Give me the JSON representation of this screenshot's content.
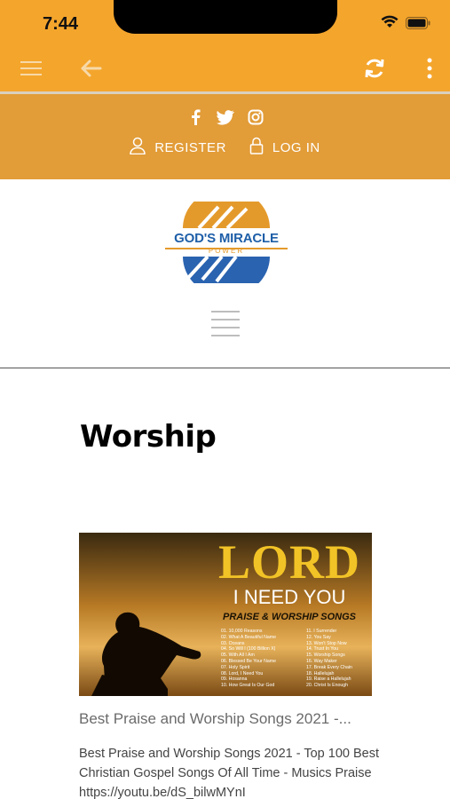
{
  "status_bar": {
    "time": "7:44"
  },
  "colors": {
    "app_bar": "#F4A52C",
    "site_header": "#E29C38",
    "logo_blue": "#1f5fa8",
    "logo_orange": "#E49A2B"
  },
  "toolbar": {
    "menu_icon": "hamburger-icon",
    "back_icon": "arrow-left-icon",
    "refresh_icon": "refresh-icon",
    "more_icon": "more-vertical-icon"
  },
  "header": {
    "social": [
      "facebook-icon",
      "twitter-icon",
      "instagram-icon"
    ],
    "register_label": "REGISTER",
    "login_label": "LOG IN"
  },
  "logo": {
    "title": "GOD'S MIRACLE",
    "subtitle": "POWER"
  },
  "main": {
    "page_title": "Worship",
    "post": {
      "thumbnail": {
        "headline": "LORD",
        "subheadline": "I NEED YOU",
        "tagline": "PRAISE & WORSHIP SONGS",
        "tracks_left": [
          "01. 10,000 Reasons",
          "02. What A Beautiful Name",
          "03. Oceans",
          "04. So Will I (100 Billion X)",
          "05. With All I Am",
          "06. Blessed Be Your Name",
          "07. Holy Spirit",
          "08. Lord, I Need You",
          "09. Hosanna",
          "10. How Great Is Our God"
        ],
        "tracks_right": [
          "11. I Surrender",
          "12. You Say",
          "13. Won't Stop Now",
          "14. Trust In You",
          "15. Worship Songs",
          "16. Way Maker",
          "17. Break Every Chain",
          "18. Hallelujah",
          "19. Raise a Hallelujah",
          "20. Christ Is Enough"
        ]
      },
      "title": "Best Praise and Worship Songs 2021 -...",
      "excerpt": "Best Praise and Worship Songs 2021 - Top 100 Best Christian Gospel Songs Of All Time - Musics Praise https://youtu.be/dS_bilwMYnI"
    }
  }
}
